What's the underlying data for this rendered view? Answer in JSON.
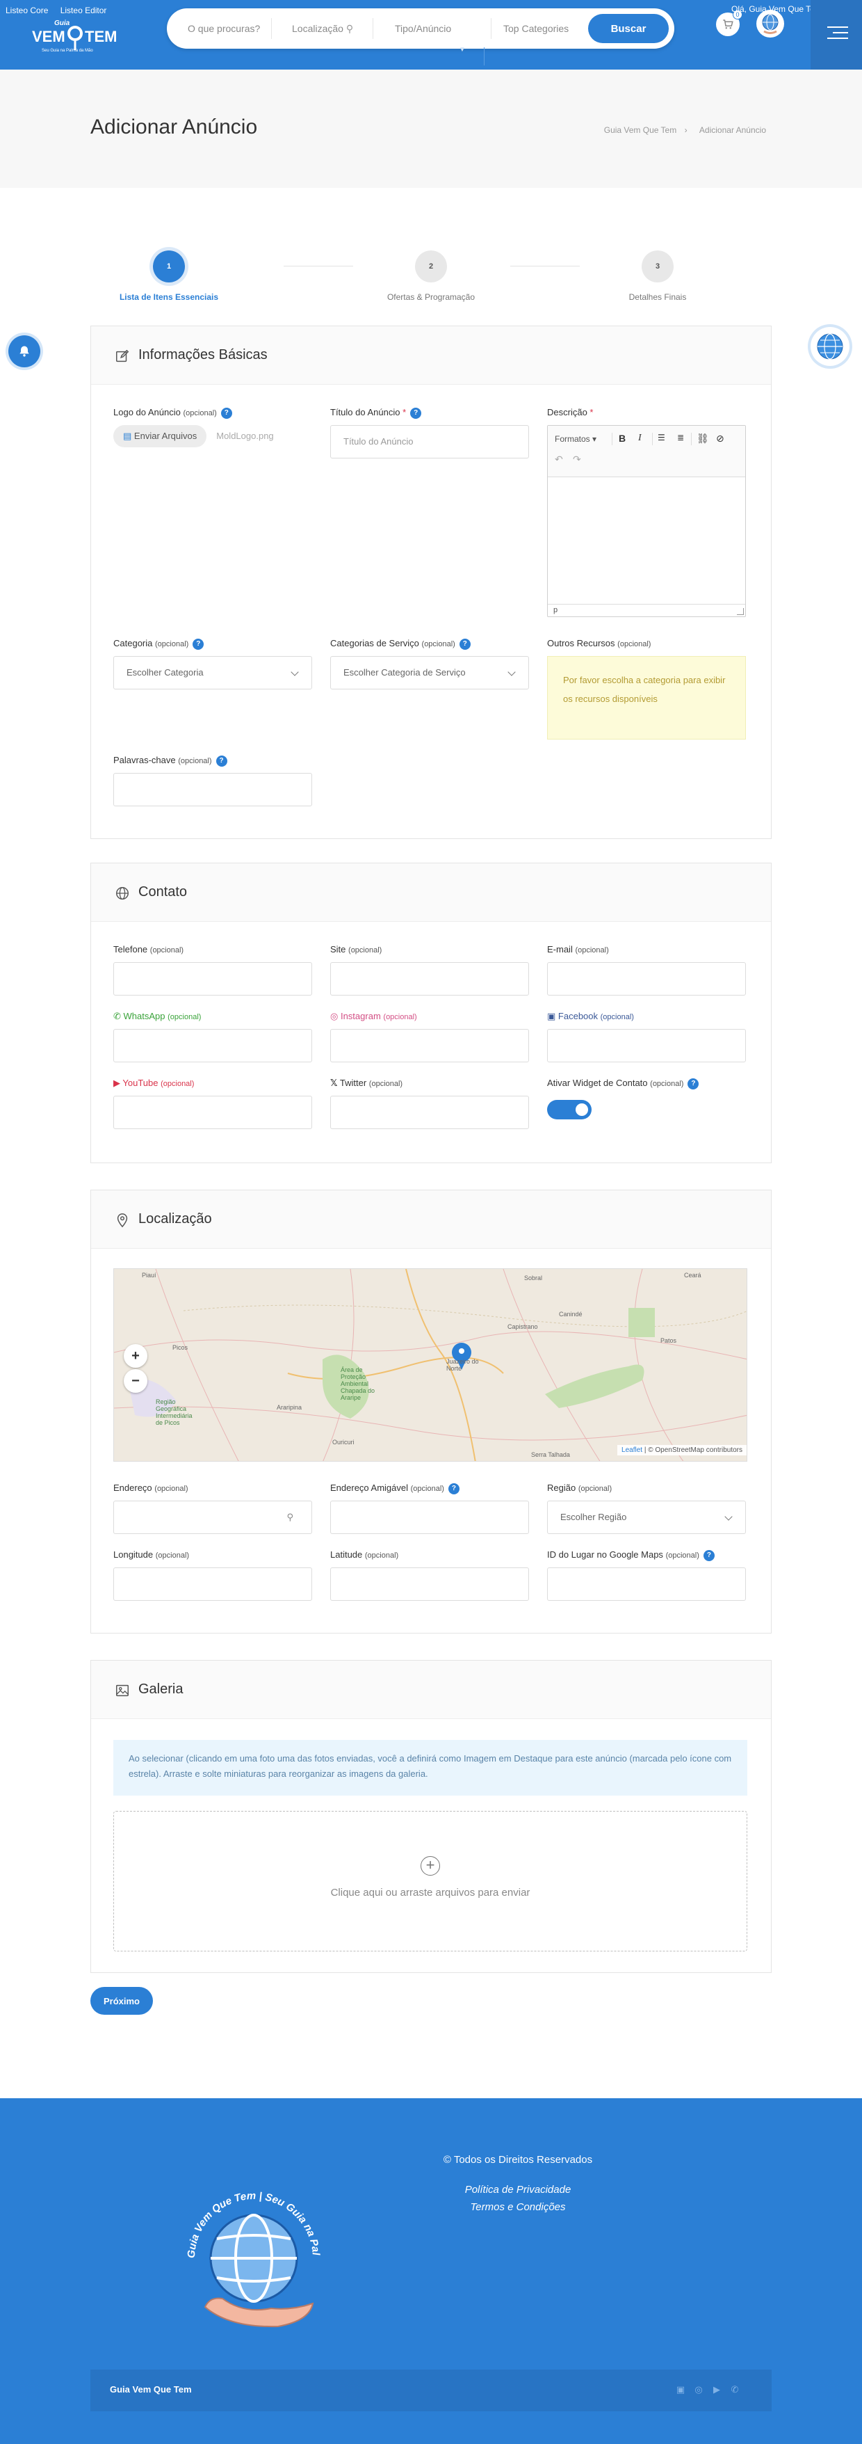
{
  "header": {
    "admin_links": [
      "Listeo Core",
      "Listeo Editor"
    ],
    "logo_alt": "Guia Vem Que Tem",
    "search": {
      "what_placeholder": "O que procuras?",
      "location_placeholder": "Localização",
      "type_placeholder": "Tipo/Anúncio",
      "category_placeholder": "Top Categories",
      "button_label": "Buscar"
    },
    "cart_count": "0",
    "greeting": "Olá, Guia Vem Que Tem"
  },
  "title_bar": {
    "title": "Adicionar Anúncio",
    "breadcrumb": [
      "Guia Vem Que Tem",
      "Adicionar Anúncio"
    ]
  },
  "steps": [
    {
      "num": "1",
      "label": "Lista de Itens Essenciais"
    },
    {
      "num": "2",
      "label": "Ofertas & Programação"
    },
    {
      "num": "3",
      "label": "Detalhes Finais"
    }
  ],
  "basic": {
    "title": "Informações Básicas",
    "logo_label": "Logo do Anúncio",
    "optional": "(opcional)",
    "upload_button": "Enviar Arquivos",
    "upload_file": "MoldLogo.png",
    "listing_title_label": "Título do Anúncio",
    "required_mark": "*",
    "listing_title_placeholder": "Título do Anúncio",
    "description_label": "Descrição",
    "editor_formats": "Formatos",
    "editor_status": "p",
    "category_label": "Categoria",
    "category_placeholder": "Escolher Categoria",
    "service_categories_label": "Categorias de Serviço",
    "service_categories_placeholder": "Escolher Categoria de Serviço",
    "other_features_label": "Outros Recursos",
    "other_features_notice": "Por favor escolha a categoria para exibir os recursos disponíveis",
    "keywords_label": "Palavras-chave"
  },
  "contact": {
    "title": "Contato",
    "phone_label": "Telefone",
    "site_label": "Site",
    "email_label": "E-mail",
    "whatsapp_label": "WhatsApp",
    "instagram_label": "Instagram",
    "facebook_label": "Facebook",
    "youtube_label": "YouTube",
    "twitter_label": "Twitter",
    "widget_label": "Ativar Widget de Contato",
    "optional": "(opcional)",
    "colors": {
      "whatsapp": "#3aa33a",
      "instagram": "#d34e84",
      "facebook": "#3b5998",
      "youtube": "#d9334a"
    }
  },
  "location": {
    "title": "Localização",
    "map_labels": {
      "piaui": "Piauí",
      "ceara": "Ceará",
      "caninde": "Canindé",
      "sobral": "Sobral",
      "picos": "Picos",
      "capistrano": "Capistrano",
      "patos": "Patos",
      "regiao": "Região Geográfica Intermediária de Picos",
      "araripina": "Araripina",
      "area": "Área de Proteção Ambiental Chapada do Araripe",
      "juazeiro": "Juazeiro do Norte",
      "ouricuri": "Ouricuri",
      "serra": "Serra Talhada"
    },
    "zoom_in": "+",
    "zoom_out": "−",
    "attribution_leaflet": "Leaflet",
    "attribution_rest": "| © OpenStreetMap contributors",
    "address_label": "Endereço",
    "friendly_address_label": "Endereço Amigável",
    "region_label": "Região",
    "region_placeholder": "Escolher Região",
    "longitude_label": "Longitude",
    "latitude_label": "Latitude",
    "google_place_label": "ID do Lugar no Google Maps",
    "optional": "(opcional)"
  },
  "gallery": {
    "title": "Galeria",
    "notice": "Ao selecionar (clicando em uma foto uma das fotos enviadas, você a definirá como Imagem em Destaque para este anúncio (marcada pelo ícone com estrela). Arraste e solte miniaturas para reorganizar as imagens da galeria.",
    "dropzone_text": "Clique aqui ou arraste arquivos para enviar"
  },
  "next_button": "Próximo",
  "footer": {
    "logo_ring_text": "Guia Vem Que Tem | Seu Guia na Palma da Mão!",
    "copyright": "© Todos os Direitos Reservados",
    "privacy": "Política de Privacidade",
    "terms": "Termos e Condições",
    "brand": "Guia Vem Que Tem",
    "social_icons": [
      "facebook-icon",
      "instagram-icon",
      "youtube-icon",
      "whatsapp-icon"
    ]
  },
  "colors": {
    "brand": "#2b7fd5",
    "footer_bottom": "#2874c4",
    "notice_yellow": "#fdfbd9",
    "notice_blue": "#e9f5fd"
  }
}
